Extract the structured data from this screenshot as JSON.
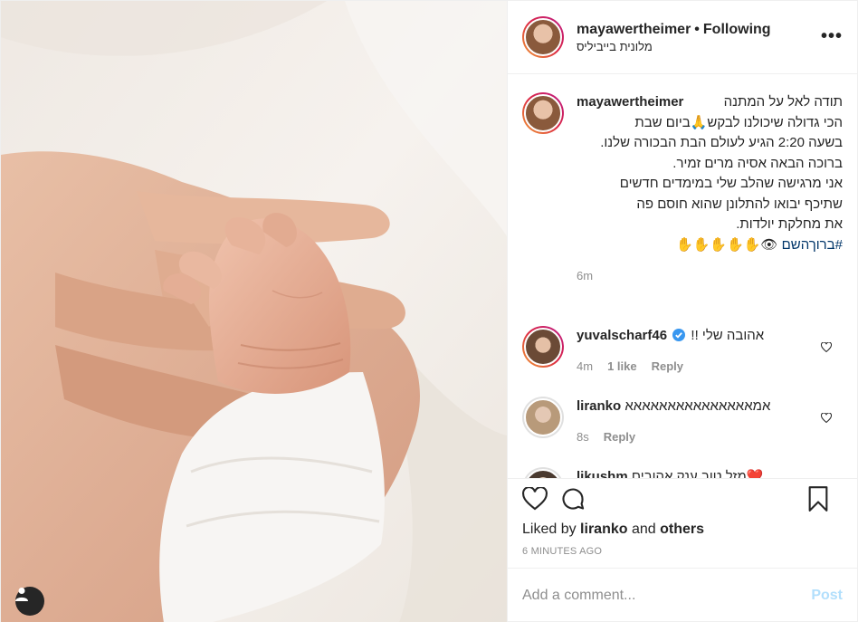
{
  "header": {
    "username": "mayawertheimer",
    "separator": "•",
    "follow_status": "Following",
    "location": "מלונית בייביליס",
    "more_label": "•••"
  },
  "caption": {
    "username": "mayawertheimer",
    "lines": [
      "תודה לאל על המתנה",
      "הכי גדולה שיכולנו לבקש🙏ביום שבת",
      "בשעה 2:20 הגיע לעולם הבת הבכורה שלנו.",
      "ברוכה הבאה אסיה מרים זמיר.",
      "אני מרגישה שהלב שלי במימדים חדשים",
      "שתיכף יבואו להתלונן שהוא חוסם פה",
      "את מחלקת יולדות."
    ],
    "hashtag": "#ברוךהשם",
    "emojis": "👁✋✋✋✋✋",
    "time": "6m"
  },
  "comments": [
    {
      "username": "yuvalscharf46",
      "verified": true,
      "text": "אהובה שלי !!",
      "time": "4m",
      "likes": "1 like",
      "reply": "Reply"
    },
    {
      "username": "liranko",
      "verified": false,
      "text": "אמאאאאאאאאאאאאאאא",
      "time": "8s",
      "likes": "",
      "reply": "Reply"
    },
    {
      "username": "likushm",
      "verified": false,
      "text": "❤️מזל טוב ענק אהובים",
      "time": "",
      "likes": "",
      "reply": ""
    }
  ],
  "likes": {
    "prefix": "Liked by",
    "user": "liranko",
    "and": "and",
    "others": "others"
  },
  "timestamp": "6 MINUTES AGO",
  "add_comment": {
    "placeholder": "Add a comment...",
    "post_label": "Post"
  },
  "colors": {
    "text": "#262626",
    "secondary": "#8e8e8e",
    "link": "#003569",
    "post_disabled": "#b2dffc",
    "verified": "#3897f0"
  }
}
